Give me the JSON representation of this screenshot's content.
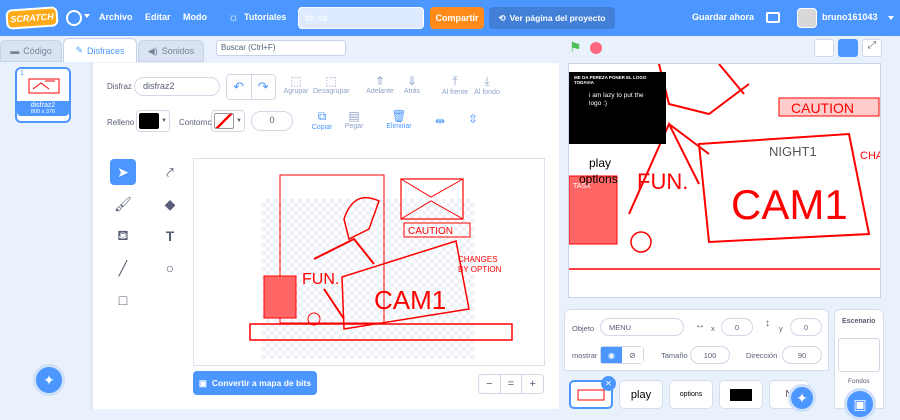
{
  "menu": {
    "logo": "SCRATCH",
    "file": "Archivo",
    "edit": "Editar",
    "mode": "Modo",
    "tutorials": "Tutoriales",
    "project_title": "tfo xd",
    "share": "Compartir",
    "see_project": "Ver página del proyecto",
    "save_now": "Guardar ahora",
    "username": "bruno161043"
  },
  "tabs": {
    "code": "Código",
    "costumes": "Disfraces",
    "sounds": "Sonidos",
    "search_placeholder": "Buscar (Ctrl+F)"
  },
  "costume": {
    "index": "1",
    "name": "disfraz2",
    "size": "800 x 376"
  },
  "toolbar": {
    "costume_label": "Disfraz",
    "costume_value": "disfraz2",
    "group": "Agrupar",
    "ungroup": "Desagrupar",
    "forward": "Adelante",
    "backward": "Atrás",
    "front": "Al frente",
    "back": "Al fondo",
    "fill_label": "Relleno",
    "outline_label": "Contorno",
    "outline_width": "0",
    "copy": "Copiar",
    "paste": "Pegar",
    "delete": "Eliminar"
  },
  "canvas_text": {
    "changes": "CHANGES",
    "by_option": "BY OPTION",
    "caution": "CAUTION",
    "fun": "FUN.",
    "cam": "CAM1"
  },
  "bitmap_button": "Convertir a mapa de bits",
  "zoom": {
    "out": "−",
    "reset": "=",
    "in": "+"
  },
  "stage_text": {
    "black_title": "ME DA PEREZA PONER EL LOGO TODAVIA",
    "black_body": "i am lazy to put the logo :)",
    "play": "play",
    "options": "options",
    "caution": "CAUTION",
    "night": "NIGHT1",
    "cam": "CAM1",
    "fun": "FUN.",
    "cha": "CHA",
    "task": "TASK"
  },
  "sprite_info": {
    "sprite_label": "Objeto",
    "sprite_name": "MENU",
    "x_label": "x",
    "x_value": "0",
    "y_label": "y",
    "y_value": "0",
    "show_label": "mostrar",
    "size_label": "Tamaño",
    "size_value": "100",
    "direction_label": "Dirección",
    "direction_value": "90"
  },
  "sprites": [
    "",
    "play",
    "options",
    "",
    "N"
  ],
  "stage_panel": {
    "title": "Escenario",
    "backdrops": "Fondos"
  },
  "colors": {
    "accent": "#4c97ff",
    "menu_bar": "#4c97ff",
    "share": "#ff8c1a",
    "drawing": "#ff0000"
  }
}
